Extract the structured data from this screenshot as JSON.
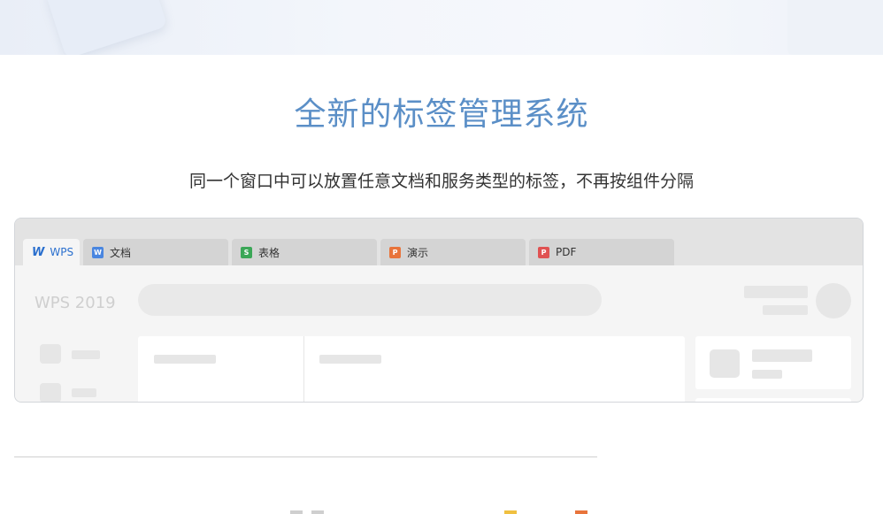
{
  "section": {
    "title": "全新的标签管理系统",
    "subtitle": "同一个窗口中可以放置任意文档和服务类型的标签，不再按组件分隔"
  },
  "mock_window": {
    "tabs": [
      {
        "label": "WPS",
        "icon": "wps-logo-icon",
        "active": true,
        "color": "#2a6fce"
      },
      {
        "label": "文档",
        "icon": "writer-doc-icon",
        "active": false,
        "color": "#4a86e0"
      },
      {
        "label": "表格",
        "icon": "spreadsheet-icon",
        "active": false,
        "color": "#3ba757"
      },
      {
        "label": "演示",
        "icon": "presentation-icon",
        "active": false,
        "color": "#e8743b"
      },
      {
        "label": "PDF",
        "icon": "pdf-icon",
        "active": false,
        "color": "#e05252"
      }
    ],
    "brand_text": "WPS 2019"
  },
  "colors": {
    "title": "#5b8fc7",
    "subtitle": "#333333",
    "accent_blue": "#2a6fce"
  }
}
